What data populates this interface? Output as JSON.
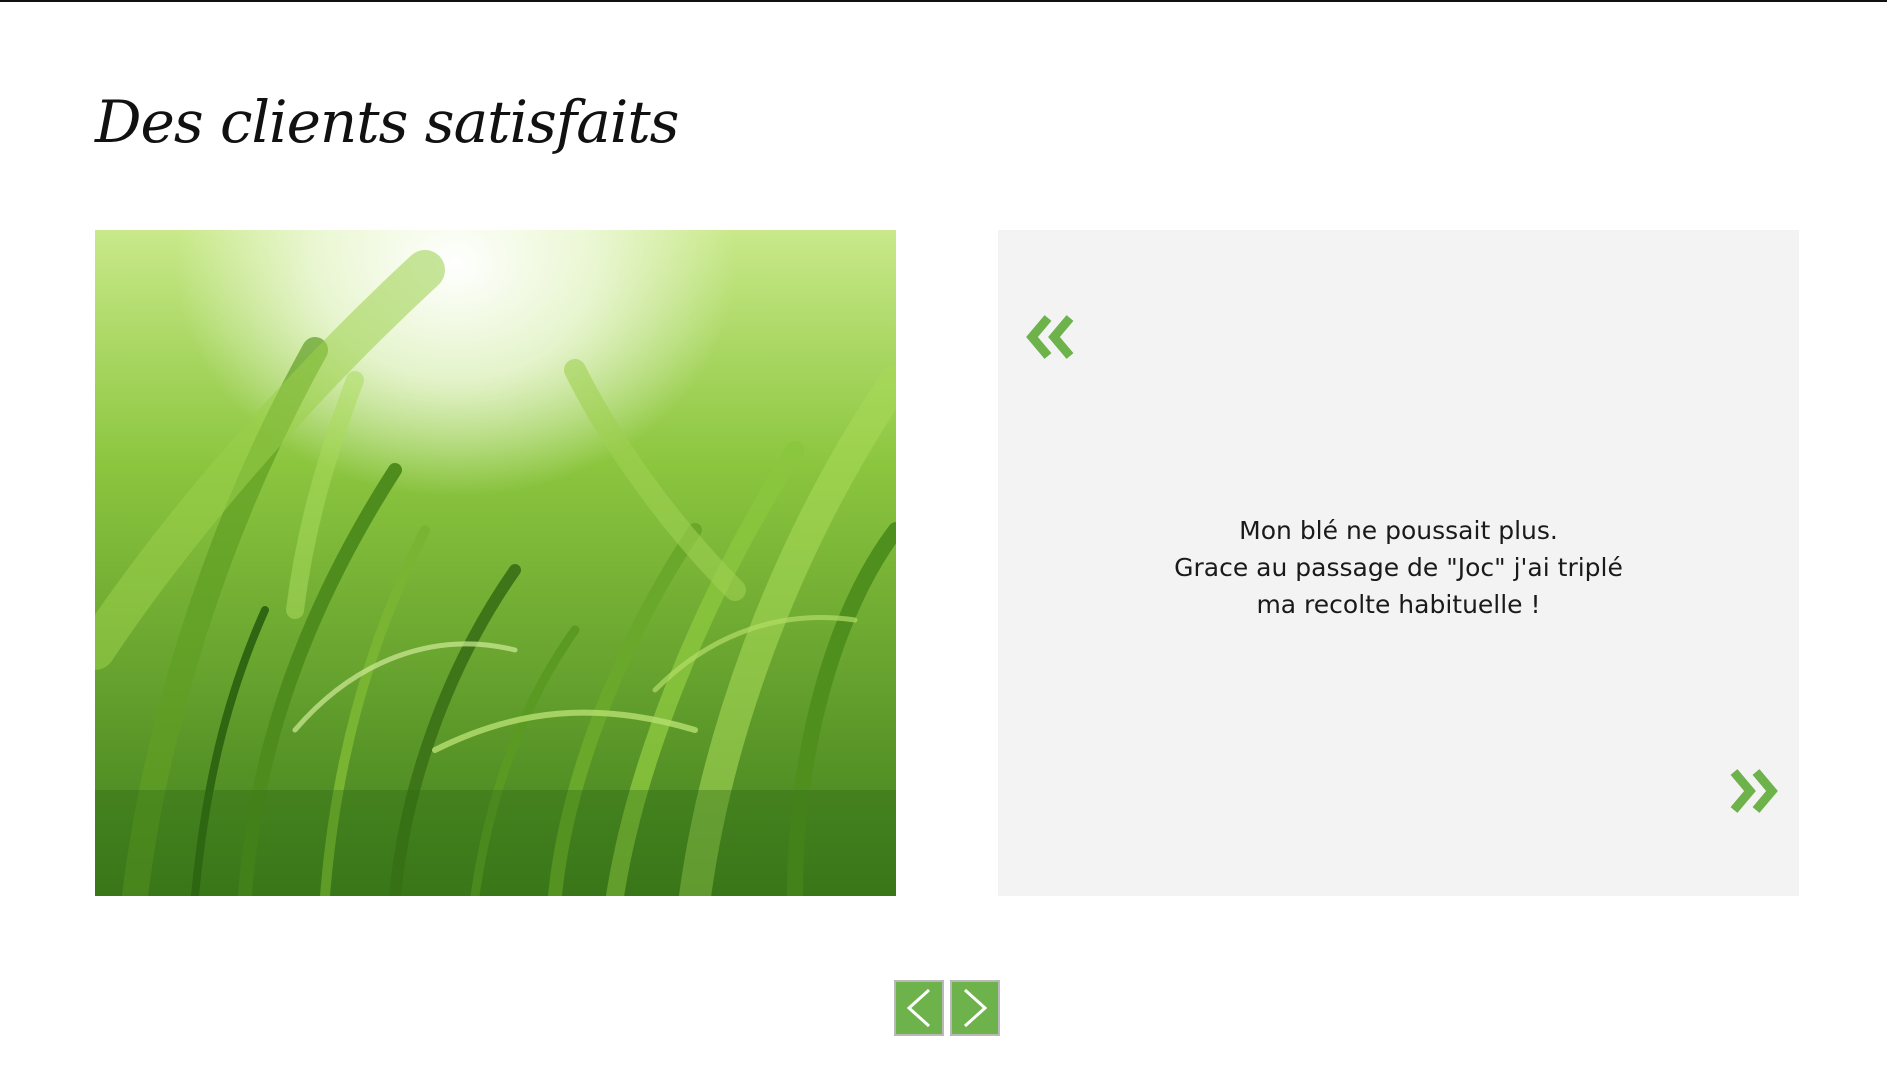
{
  "section": {
    "title": "Des clients satisfaits"
  },
  "testimonial": {
    "image": "wheat-field-photo",
    "lines": [
      "Mon blé ne poussait plus.",
      "Grace au passage de \"Joc\" j'ai triplé",
      "ma recolte habituelle !"
    ],
    "quote_open_icon": "double-chevron-left-icon",
    "quote_close_icon": "double-chevron-right-icon"
  },
  "pager": {
    "prev_icon": "chevron-left-icon",
    "next_icon": "chevron-right-icon"
  },
  "colors": {
    "accent": "#6db24a",
    "panel": "#f3f3f3",
    "text": "#1a1a1a"
  }
}
